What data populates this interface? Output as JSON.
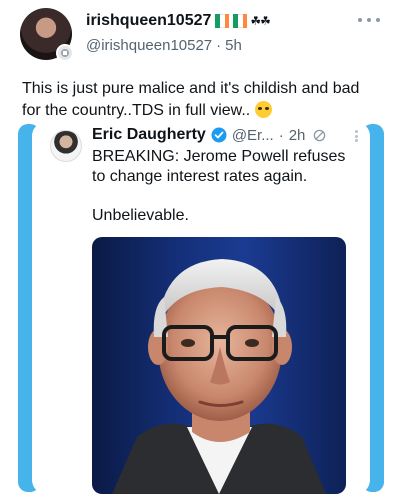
{
  "post": {
    "display_name": "irishqueen10527",
    "handle": "@irishqueen10527",
    "separator": "·",
    "time": "5h",
    "shamrocks": "☘☘",
    "text": "This is just pure malice and it's childish and bad for the country..TDS in full view.."
  },
  "quoted": {
    "display_name": "Eric Daugherty",
    "handle": "@Er...",
    "separator": "·",
    "time": "2h",
    "text": "BREAKING: Jerome Powell refuses to change interest rates again.",
    "text2": "Unbelievable."
  },
  "colors": {
    "accent": "#46b3ea",
    "verified": "#1d9bf0",
    "flag_green": "#169b62",
    "flag_white": "#ffffff",
    "flag_orange": "#ff883e"
  },
  "icons": [
    "more-icon",
    "verified-icon",
    "grok-icon",
    "flag-icon",
    "shamrock-icon",
    "emoji-icon"
  ]
}
